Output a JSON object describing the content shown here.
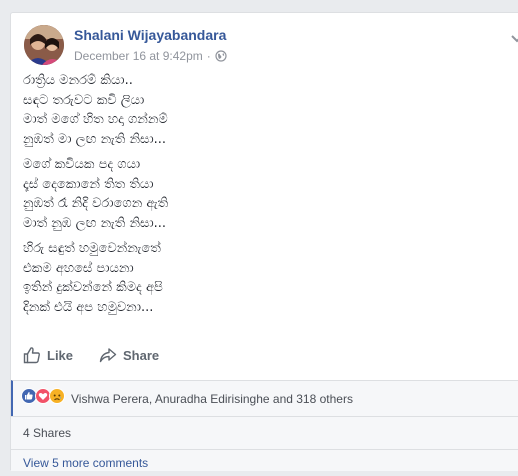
{
  "post": {
    "author": "Shalani Wijayabandara",
    "date": "December 16 at 9:42pm",
    "separator": "·",
    "privacy_icon": "globe-icon",
    "menu_icon": "chevron-down-icon"
  },
  "poem": {
    "stanzas": [
      {
        "lines": [
          "රාත්‍රිය මනරම් කියා..",
          "සඳට තරුවට කවි ලියා",
          "මාත් මගේ හිත හදා ගන්නම්",
          "නුඹත් මා ලඟ නැති නිසා..."
        ]
      },
      {
        "lines": [
          "මගේ කවියක පද ගයා",
          "දෑස් දෙකොනේ තිත තියා",
          "නුඹත් රෑ නිදි වරාගෙන ඇති",
          "මාත් නුඹ ලඟ නැති නිසා..."
        ]
      },
      {
        "lines": [
          "හිරු සඳුත් හමුවෙන්නැතේ",
          "එකම අහසේ පායනා",
          "ඉතින් දුක්වන්නේ කිමද අපි",
          "දිනක් එයි අප හමුවනා..."
        ]
      }
    ]
  },
  "actions": {
    "like_label": "Like",
    "share_label": "Share"
  },
  "reactions": {
    "icons": [
      "like-reaction-icon",
      "love-reaction-icon",
      "sad-reaction-icon"
    ],
    "text": "Vishwa Perera, Anuradha Edirisinghe and 318 others"
  },
  "shares": {
    "text": "4 Shares"
  },
  "comments": {
    "more_text": "View 5 more comments"
  },
  "colors": {
    "link": "#365899",
    "accent": "#4267b2",
    "muted": "#90949c",
    "love": "#f25268",
    "sad": "#f7b125"
  }
}
